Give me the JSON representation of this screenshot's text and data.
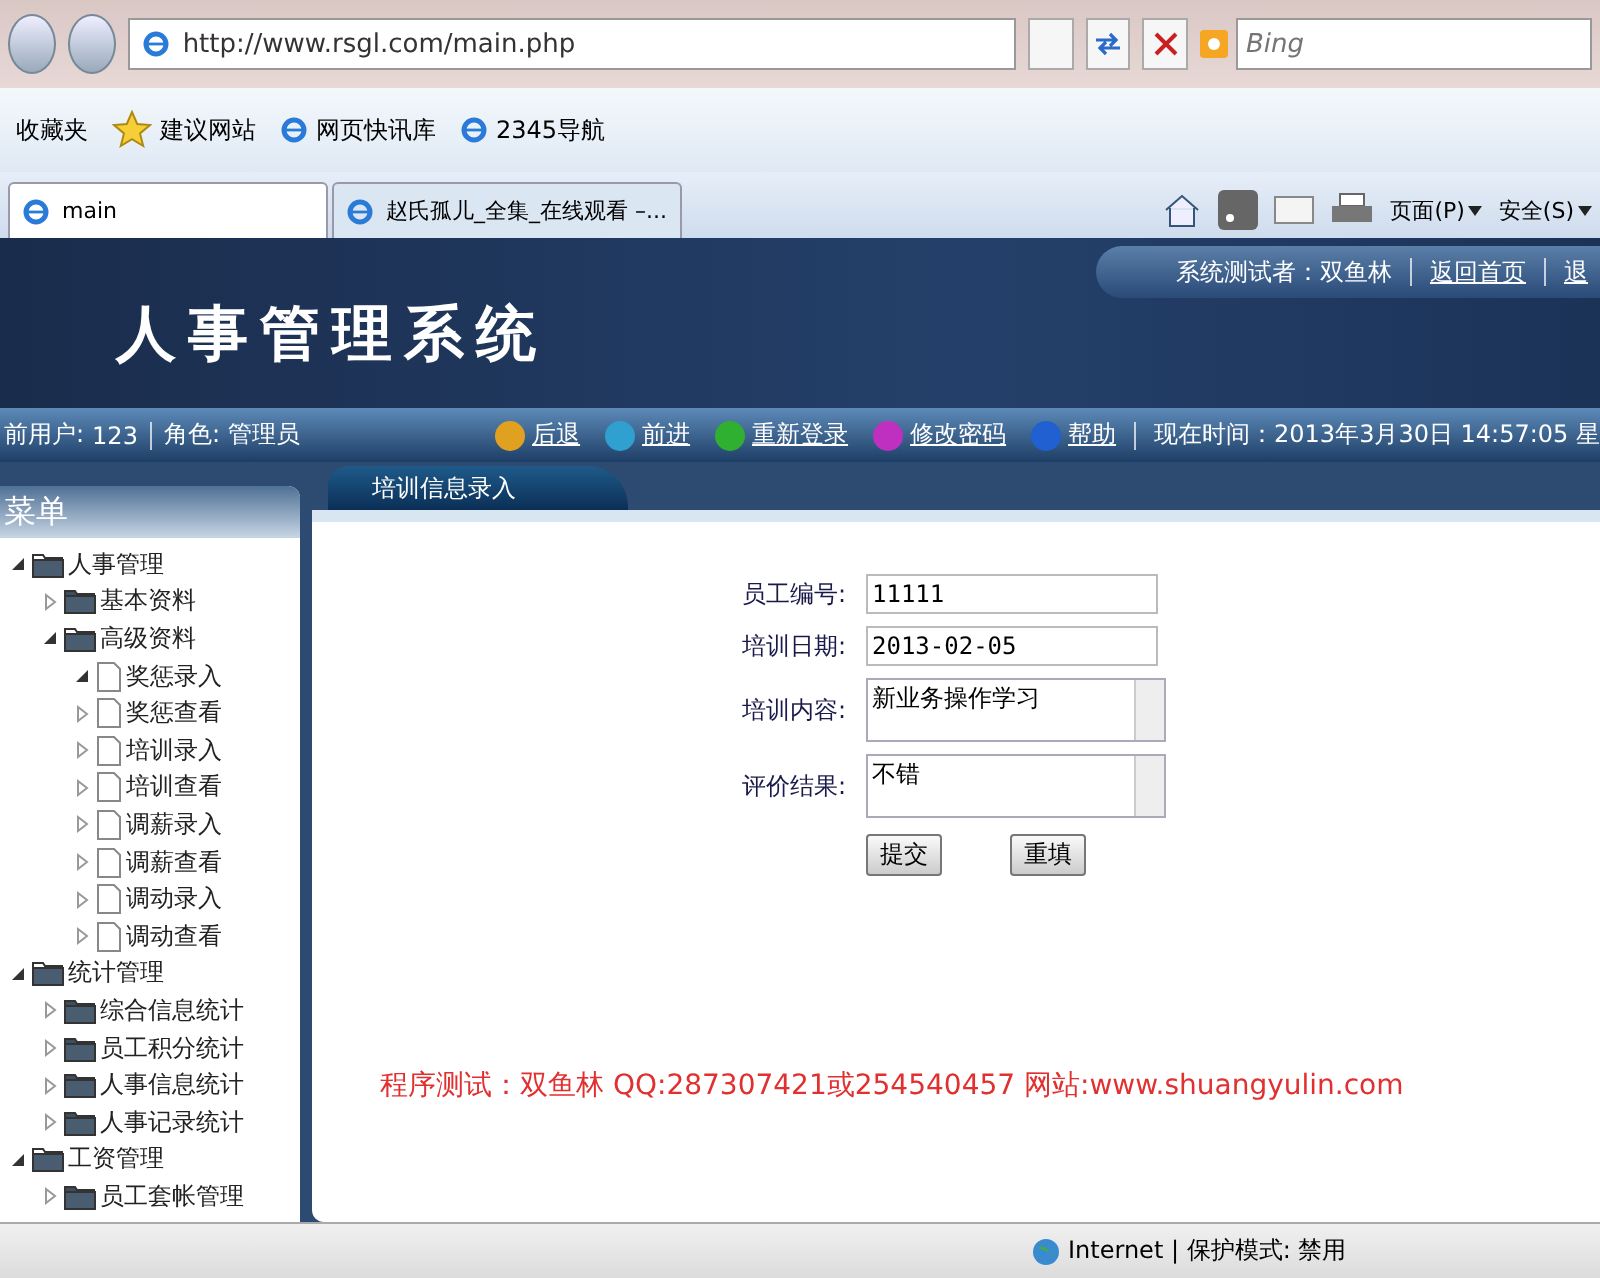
{
  "browser": {
    "address": "http://www.rsgl.com/main.php",
    "search": {
      "placeholder": "Bing"
    },
    "favorites": [
      "收藏夹",
      "建议网站",
      "网页快讯库",
      "2345导航"
    ],
    "tabs": [
      {
        "label": "main",
        "selected": true
      },
      {
        "label": "赵氏孤儿_全集_在线观看 –...",
        "selected": false
      }
    ],
    "commands": [
      "页面(P)",
      "安全(S)"
    ]
  },
  "header": {
    "logo": "人事管理系统",
    "tester": "系统测试者：双鱼林",
    "links": [
      "返回首页",
      "退"
    ]
  },
  "nav": {
    "user_label": "前用户:",
    "user": "123",
    "role_label": "角色:",
    "role": "管理员",
    "buttons": [
      {
        "label": "后退",
        "color": "#e0a020"
      },
      {
        "label": "前进",
        "color": "#30a0d0"
      },
      {
        "label": "重新登录",
        "color": "#30b030"
      },
      {
        "label": "修改密码",
        "color": "#c030c0"
      },
      {
        "label": "帮助",
        "color": "#2060d0"
      }
    ],
    "time": "现在时间：2013年3月30日 14:57:05 星"
  },
  "sidebar": {
    "title": "菜单",
    "tree": [
      {
        "label": "人事管理",
        "expanded": true,
        "children": [
          {
            "label": "基本资料",
            "expanded": false
          },
          {
            "label": "高级资料",
            "expanded": true,
            "children": [
              {
                "label": "奖惩录入",
                "expanded": true
              },
              {
                "label": "奖惩查看",
                "expanded": false
              },
              {
                "label": "培训录入",
                "expanded": false
              },
              {
                "label": "培训查看",
                "expanded": false
              },
              {
                "label": "调薪录入",
                "expanded": false
              },
              {
                "label": "调薪查看",
                "expanded": false
              },
              {
                "label": "调动录入",
                "expanded": false
              },
              {
                "label": "调动查看",
                "expanded": false
              }
            ]
          }
        ]
      },
      {
        "label": "统计管理",
        "expanded": true,
        "children": [
          {
            "label": "综合信息统计",
            "expanded": false
          },
          {
            "label": "员工积分统计",
            "expanded": false
          },
          {
            "label": "人事信息统计",
            "expanded": false
          },
          {
            "label": "人事记录统计",
            "expanded": false
          }
        ]
      },
      {
        "label": "工资管理",
        "expanded": true,
        "children": [
          {
            "label": "员工套帐管理",
            "expanded": false
          }
        ]
      }
    ]
  },
  "content": {
    "tab": "培训信息录入",
    "fields": [
      {
        "label": "员工编号:",
        "kind": "input",
        "value": "11111"
      },
      {
        "label": "培训日期:",
        "kind": "input",
        "value": "2013-02-05"
      },
      {
        "label": "培训内容:",
        "kind": "textarea",
        "value": "新业务操作学习"
      },
      {
        "label": "评价结果:",
        "kind": "textarea",
        "value": "不错"
      }
    ],
    "buttons": [
      "提交",
      "重填"
    ],
    "footer": "程序测试：双鱼林 QQ:287307421或254540457 网站:www.shuangyulin.com"
  },
  "status_bar": {
    "zone": "Internet | 保护模式: 禁用"
  }
}
